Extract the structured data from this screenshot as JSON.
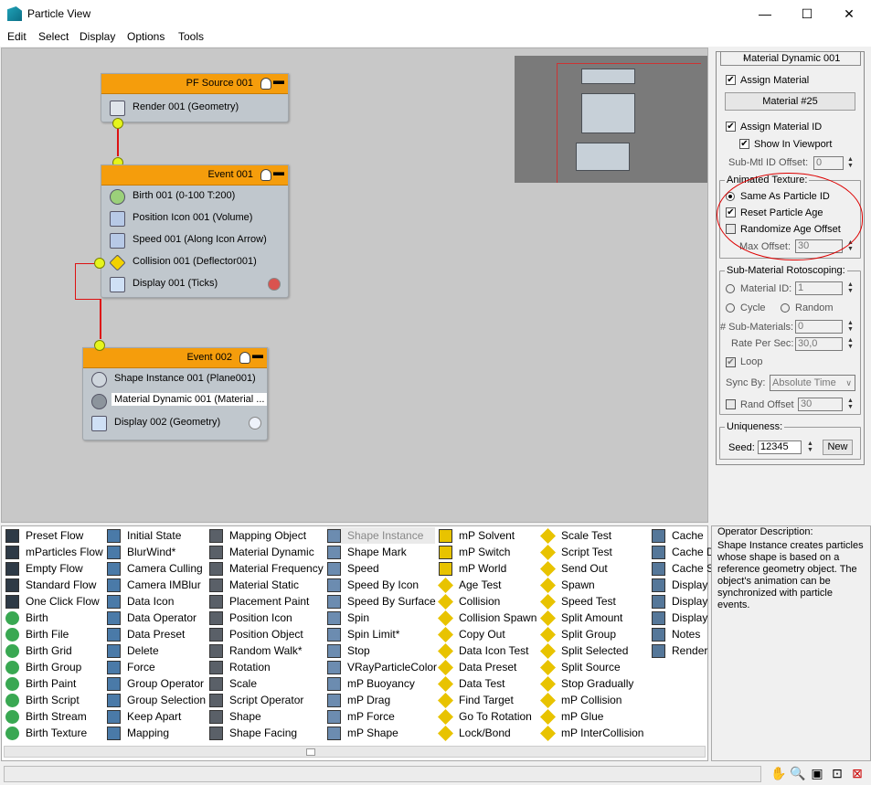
{
  "window": {
    "title": "Particle View",
    "minimize": "—",
    "maximize": "☐",
    "close": "✕"
  },
  "menu": [
    "Edit",
    "Select",
    "Display",
    "Options",
    "Tools"
  ],
  "events": [
    {
      "title": "PF Source 001",
      "operators": [
        "Render 001 (Geometry)"
      ]
    },
    {
      "title": "Event 001",
      "operators": [
        "Birth 001 (0-100 T:200)",
        "Position Icon 001 (Volume)",
        "Speed 001 (Along Icon Arrow)",
        "Collision 001 (Deflector001)",
        "Display 001 (Ticks)"
      ]
    },
    {
      "title": "Event 002",
      "operators": [
        "Shape Instance 001 (Plane001)",
        "Material Dynamic 001 (Material ...",
        "Display 002 (Geometry)"
      ]
    }
  ],
  "panel": {
    "title": "Material Dynamic 001",
    "assign_material": "Assign Material",
    "material_button": "Material #25",
    "assign_material_id": "Assign Material ID",
    "show_in_viewport": "Show In Viewport",
    "submtl_offset_label": "Sub-Mtl ID Offset:",
    "submtl_offset_value": "0",
    "animated_texture": "Animated Texture:",
    "same_as_particle_id": "Same As Particle ID",
    "reset_particle_age": "Reset Particle Age",
    "randomize_age_offset": "Randomize Age Offset",
    "max_offset_label": "Max Offset:",
    "max_offset_value": "30",
    "roto_title": "Sub-Material Rotoscoping:",
    "material_id_label": "Material ID:",
    "material_id_value": "1",
    "cycle": "Cycle",
    "random": "Random",
    "num_submaterials_label": "# Sub-Materials:",
    "num_submaterials_value": "0",
    "rate_per_sec_label": "Rate Per Sec:",
    "rate_per_sec_value": "30,0",
    "loop": "Loop",
    "sync_by_label": "Sync By:",
    "sync_by_value": "Absolute Time",
    "rand_offset_label": "Rand Offset",
    "rand_offset_value": "30",
    "uniqueness_title": "Uniqueness:",
    "seed_label": "Seed:",
    "seed_value": "12345",
    "new_button": "New"
  },
  "depot_columns": [
    [
      "Preset Flow",
      "mParticles Flow",
      "Empty Flow",
      "Standard Flow",
      "One Click Flow",
      "Birth",
      "Birth File",
      "Birth Grid",
      "Birth Group",
      "Birth Paint",
      "Birth Script",
      "Birth Stream",
      "Birth Texture"
    ],
    [
      "Initial State",
      "BlurWind*",
      "Camera Culling",
      "Camera IMBlur",
      "Data Icon",
      "Data Operator",
      "Data Preset",
      "Delete",
      "Force",
      "Group Operator",
      "Group Selection",
      "Keep Apart",
      "Mapping"
    ],
    [
      "Mapping Object",
      "Material Dynamic",
      "Material Frequency",
      "Material Static",
      "Placement Paint",
      "Position Icon",
      "Position Object",
      "Random Walk*",
      "Rotation",
      "Scale",
      "Script Operator",
      "Shape",
      "Shape Facing"
    ],
    [
      "Shape Instance",
      "Shape Mark",
      "Speed",
      "Speed By Icon",
      "Speed By Surface",
      "Spin",
      "Spin Limit*",
      "Stop",
      "VRayParticleColor",
      "mP Buoyancy",
      "mP Drag",
      "mP Force",
      "mP Shape"
    ],
    [
      "mP Solvent",
      "mP Switch",
      "mP World",
      "Age Test",
      "Collision",
      "Collision Spawn",
      "Copy Out",
      "Data Icon Test",
      "Data Preset",
      "Data Test",
      "Find Target",
      "Go To Rotation",
      "Lock/Bond"
    ],
    [
      "Scale Test",
      "Script Test",
      "Send Out",
      "Spawn",
      "Speed Test",
      "Split Amount",
      "Split Group",
      "Split Selected",
      "Split Source",
      "Stop Gradually",
      "mP Collision",
      "mP Glue",
      "mP InterCollision"
    ],
    [
      "Cache",
      "Cache D",
      "Cache S",
      "Display",
      "Display",
      "Display",
      "Notes",
      "Render"
    ]
  ],
  "description": {
    "title": "Operator Description:",
    "text": "Shape Instance creates particles whose shape is based on a reference geometry object. The object's animation can be synchronized with particle events."
  },
  "colors": {
    "event_header": "#f59d0c",
    "wire": "#dd1111",
    "port": "#e6f51c",
    "annotation": "#dd0000"
  }
}
